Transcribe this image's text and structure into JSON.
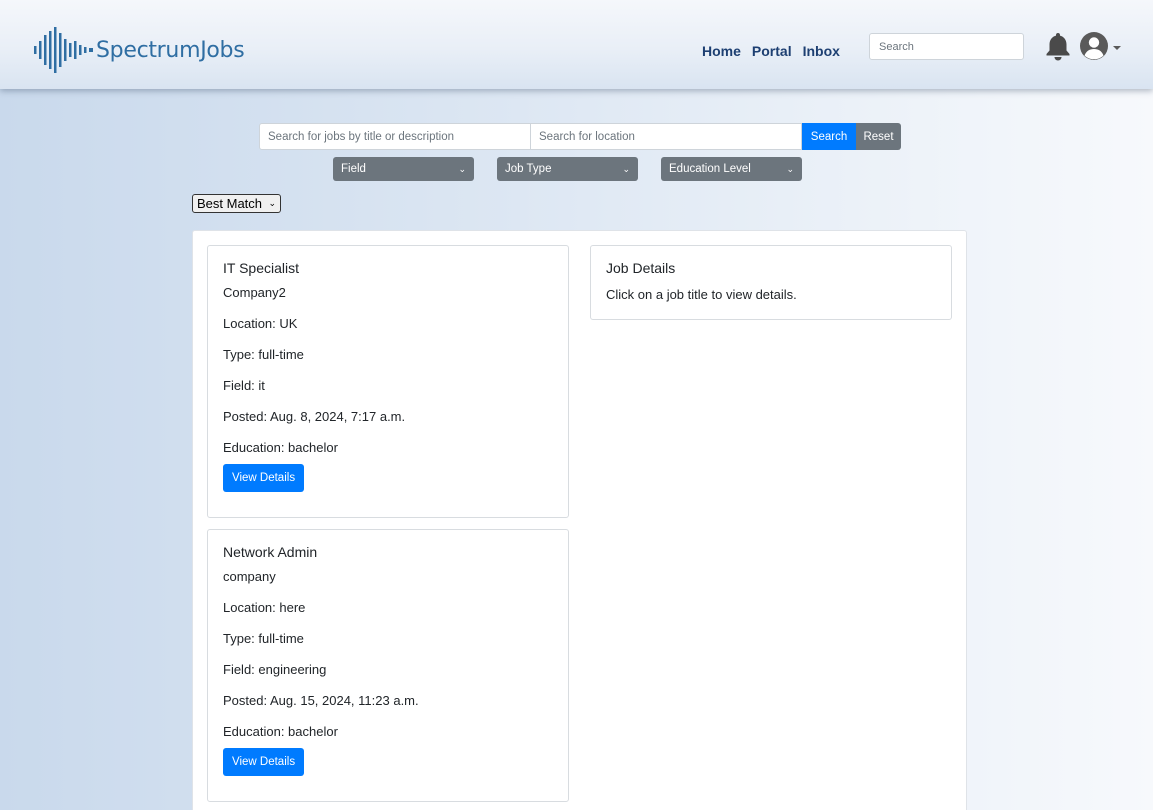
{
  "header": {
    "logo_text": "SpectrumJobs",
    "nav": [
      "Home",
      "Portal",
      "Inbox"
    ],
    "search_placeholder": "Search"
  },
  "search": {
    "title_placeholder": "Search for jobs by title or description",
    "location_placeholder": "Search for location",
    "search_label": "Search",
    "reset_label": "Reset"
  },
  "filters": {
    "field": "Field",
    "job_type": "Job Type",
    "education": "Education Level"
  },
  "sort": {
    "selected": "Best Match"
  },
  "jobs": [
    {
      "title": "IT Specialist",
      "company": "Company2",
      "location": "Location: UK",
      "type": "Type: full-time",
      "field": "Field: it",
      "posted": "Posted: Aug. 8, 2024, 7:17 a.m.",
      "education": "Education: bachelor",
      "button": "View Details"
    },
    {
      "title": "Network Admin",
      "company": "company",
      "location": "Location: here",
      "type": "Type: full-time",
      "field": "Field: engineering",
      "posted": "Posted: Aug. 15, 2024, 11:23 a.m.",
      "education": "Education: bachelor",
      "button": "View Details"
    }
  ],
  "details": {
    "title": "Job Details",
    "text": "Click on a job title to view details."
  },
  "colors": {
    "primary": "#007bff",
    "secondary": "#6c757d",
    "nav": "#1d3f72",
    "logo": "#2f6ea3"
  }
}
